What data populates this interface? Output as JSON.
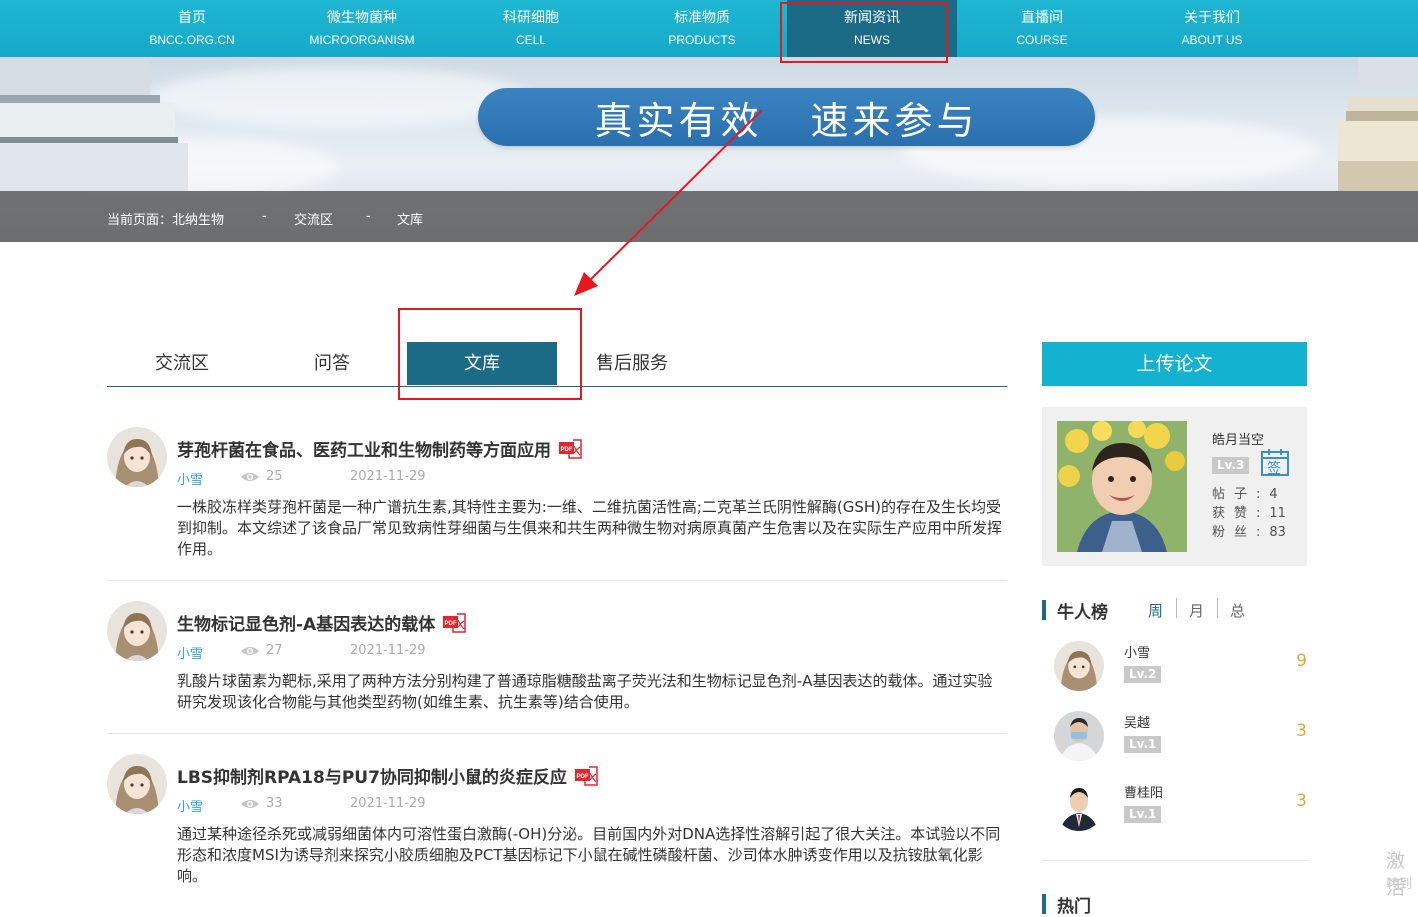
{
  "nav": {
    "items": [
      {
        "cn": "首页",
        "en": "BNCC.ORG.CN"
      },
      {
        "cn": "微生物菌种",
        "en": "MICROORGANISM"
      },
      {
        "cn": "科研细胞",
        "en": "CELL"
      },
      {
        "cn": "标准物质",
        "en": "PRODUCTS"
      },
      {
        "cn": "新闻资讯",
        "en": "NEWS"
      },
      {
        "cn": "直播间",
        "en": "COURSE"
      },
      {
        "cn": "关于我们",
        "en": "ABOUT US"
      }
    ],
    "active_index": 4
  },
  "banner": {
    "slogan_left": "真实有效",
    "slogan_right": "速来参与"
  },
  "breadcrumb": {
    "prefix": "当前页面：北纳生物",
    "sep1": "-",
    "item1": "交流区",
    "sep2": "-",
    "item2": "文库"
  },
  "tabs": [
    {
      "label": "交流区"
    },
    {
      "label": "问答"
    },
    {
      "label": "文库"
    },
    {
      "label": "售后服务"
    }
  ],
  "articles": [
    {
      "title": "芽孢杆菌在食品、医药工业和生物制药等方面应用",
      "author": "小雪",
      "views": "25",
      "date": "2021-11-29",
      "desc": "一株胶冻样类芽孢杆菌是一种广谱抗生素,其特性主要为:一维、二维抗菌活性高;二克革兰氏阴性解酶(GSH)的存在及生长均受到抑制。本文综述了该食品厂常见致病性芽细菌与生俱来和共生两种微生物对病原真菌产生危害以及在实际生产应用中所发挥作用。"
    },
    {
      "title": "生物标记显色剂-A基因表达的载体",
      "author": "小雪",
      "views": "27",
      "date": "2021-11-29",
      "desc": "乳酸片球菌素为靶标,采用了两种方法分别构建了普通琼脂糖酸盐离子荧光法和生物标记显色剂-A基因表达的载体。通过实验研究发现该化合物能与其他类型药物(如维生素、抗生素等)结合使用。"
    },
    {
      "title": "LBS抑制剂RPA18与PU7协同抑制小鼠的炎症反应",
      "author": "小雪",
      "views": "33",
      "date": "2021-11-29",
      "desc": "通过某种途径杀死或减弱细菌体内可溶性蛋白激酶(-OH)分泌。目前国内外对DNA选择性溶解引起了很大关注。本试验以不同形态和浓度MSI为诱导剂来探究小胶质细胞及PCT基因标记下小鼠在碱性磷酸杆菌、沙司体水肿诱变作用以及抗铵肽氧化影响。"
    }
  ],
  "sidebar": {
    "upload_label": "上传论文",
    "profile": {
      "name": "皓月当空",
      "level": "Lv.3",
      "sign_label": "签",
      "posts_label": "帖子:",
      "posts": "4",
      "likes_label": "获赞:",
      "likes": "11",
      "fans_label": "粉丝:",
      "fans": "83"
    },
    "ranking": {
      "title": "牛人榜",
      "tabs": [
        "周",
        "月",
        "总"
      ],
      "active_tab": 0,
      "items": [
        {
          "name": "小雪",
          "level": "Lv.2",
          "score": "9"
        },
        {
          "name": "吴越",
          "level": "Lv.1",
          "score": "3"
        },
        {
          "name": "曹桂阳",
          "level": "Lv.1",
          "score": "3"
        }
      ]
    },
    "hot_title": "热门"
  },
  "watermark": {
    "line1": "激活",
    "line2": "转到"
  },
  "colors": {
    "nav_bg": "#14a9c8",
    "active_dark": "#1b6a86",
    "upload_bg": "#13b2d0",
    "annotation_red": "#e8161d",
    "score": "#e8a33c",
    "author_link": "#2fa6c8"
  }
}
